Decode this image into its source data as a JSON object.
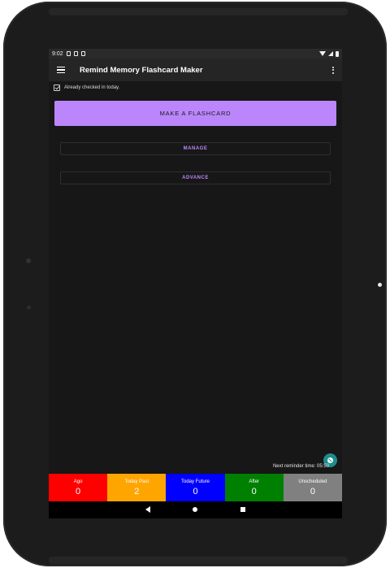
{
  "status": {
    "time": "9:02"
  },
  "app_bar": {
    "title": "Remind Memory Flashcard Maker"
  },
  "checkin": {
    "text": "Already checked in today."
  },
  "buttons": {
    "make_flashcard": "MAKE A FLASHCARD",
    "manage": "MANAGE",
    "advance": "ADVANCE"
  },
  "reminder": {
    "text": "Next reminder time: 05:50"
  },
  "stats": [
    {
      "label": "Ago",
      "value": "0",
      "color": "#ff0000"
    },
    {
      "label": "Today Past",
      "value": "2",
      "color": "#ffa500"
    },
    {
      "label": "Today Future",
      "value": "0",
      "color": "#0000ff"
    },
    {
      "label": "After",
      "value": "0",
      "color": "#008000"
    },
    {
      "label": "Unscheduled",
      "value": "0",
      "color": "#808080"
    }
  ],
  "colors": {
    "accent": "#bb86fc",
    "background": "#171717",
    "fab": "#1e8c8c"
  },
  "icons": {
    "menu": "menu-icon",
    "overflow": "overflow-menu-icon",
    "checkin": "calendar-check-icon",
    "fab": "clock-icon"
  }
}
